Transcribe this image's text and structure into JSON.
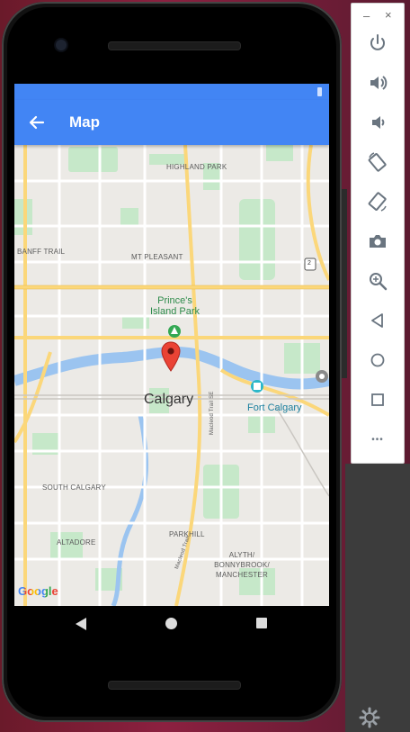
{
  "app": {
    "title": "Map"
  },
  "map": {
    "labels": {
      "highland_park": "HIGHLAND PARK",
      "banff_trail": "BANFF TRAIL",
      "mt_pleasant": "MT PLEASANT",
      "princes_island_park": "Prince's Island Park",
      "calgary": "Calgary",
      "fort_calgary": "Fort Calgary",
      "south_calgary": "SOUTH CALGARY",
      "altadore": "ALTADORE",
      "parkhill": "PARKHILL",
      "alyth": "ALYTH/ BONNYBROOK/ MANCHESTER",
      "macleod_trail": "Macleod Trail",
      "macleod_trail_se": "Macleod Trail SE",
      "highway_2": "2"
    },
    "attribution": "Google",
    "marker": "red-location-pin"
  },
  "colors": {
    "app_bar": "#4285f4",
    "map_bg": "#eceae6",
    "park": "#c6e8c9",
    "water": "#9bc4f0",
    "road_major": "#fbd77a",
    "road_minor": "#ffffff",
    "marker": "#ea4335"
  },
  "toolbar": {
    "minimize": "–",
    "close": "×",
    "more": "•••"
  }
}
